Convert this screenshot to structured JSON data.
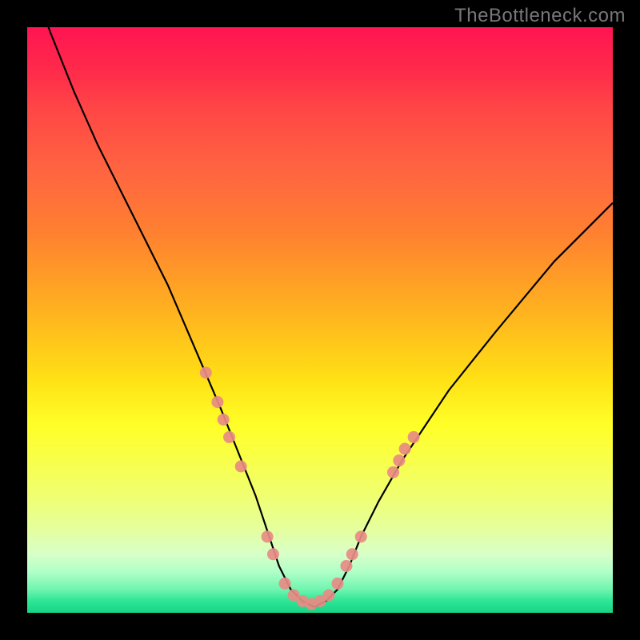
{
  "watermark": "TheBottleneck.com",
  "chart_data": {
    "type": "line",
    "title": "",
    "xlabel": "",
    "ylabel": "",
    "xlim": [
      0,
      100
    ],
    "ylim": [
      0,
      100
    ],
    "curve": {
      "name": "bottleneck-curve",
      "description": "Asymmetric V-shaped bottleneck curve. Y represents bottleneck percentage (0 = optimal at bottom, 100 = fully bottlenecked at top). Minimum (best match) occurs around x≈44-50.",
      "x": [
        0,
        4,
        8,
        12,
        16,
        20,
        24,
        27,
        30,
        33,
        35,
        37,
        39,
        41,
        43,
        45,
        47,
        49,
        51,
        53,
        55,
        57,
        60,
        64,
        68,
        72,
        76,
        80,
        85,
        90,
        95,
        100
      ],
      "y": [
        110,
        99,
        89,
        80,
        72,
        64,
        56,
        49,
        42,
        35,
        30,
        25,
        20,
        14,
        8,
        4,
        2,
        1,
        2,
        4,
        8,
        13,
        19,
        26,
        32,
        38,
        43,
        48,
        54,
        60,
        65,
        70
      ]
    },
    "markers": {
      "name": "sample-points",
      "color": "#e88b84",
      "radius_px": 7.5,
      "points": [
        {
          "x": 30.5,
          "y": 41
        },
        {
          "x": 32.5,
          "y": 36
        },
        {
          "x": 33.5,
          "y": 33
        },
        {
          "x": 34.5,
          "y": 30
        },
        {
          "x": 36.5,
          "y": 25
        },
        {
          "x": 41.0,
          "y": 13
        },
        {
          "x": 42.0,
          "y": 10
        },
        {
          "x": 44.0,
          "y": 5
        },
        {
          "x": 45.5,
          "y": 3
        },
        {
          "x": 47.0,
          "y": 2
        },
        {
          "x": 48.5,
          "y": 1.5
        },
        {
          "x": 50.0,
          "y": 2
        },
        {
          "x": 51.5,
          "y": 3
        },
        {
          "x": 53.0,
          "y": 5
        },
        {
          "x": 54.5,
          "y": 8
        },
        {
          "x": 55.5,
          "y": 10
        },
        {
          "x": 57.0,
          "y": 13
        },
        {
          "x": 62.5,
          "y": 24
        },
        {
          "x": 63.5,
          "y": 26
        },
        {
          "x": 64.5,
          "y": 28
        },
        {
          "x": 66.0,
          "y": 30
        }
      ]
    },
    "colors": {
      "curve_stroke": "#000000",
      "background_top": "#ff1452",
      "background_bottom": "#18d486",
      "marker_fill": "#e88b84"
    }
  }
}
